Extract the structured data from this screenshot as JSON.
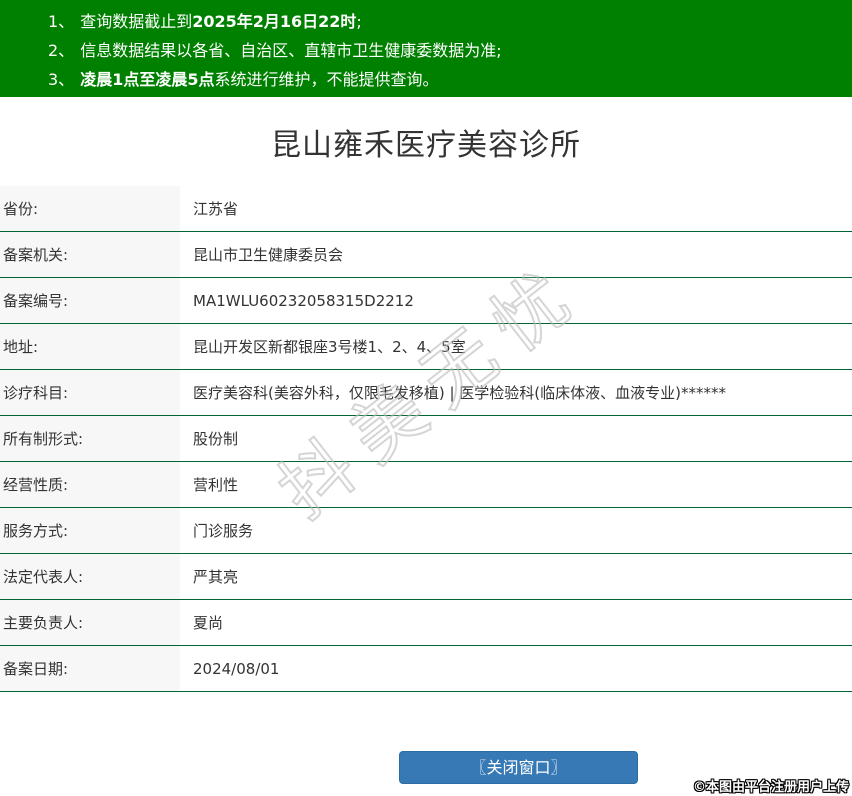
{
  "banner": {
    "background_color": "#008000",
    "lines": [
      {
        "num": "1、",
        "segments": [
          {
            "text": "查询数据截止到",
            "bold": false
          },
          {
            "text": "2025年2月16日22时",
            "bold": true
          },
          {
            "text": ";",
            "bold": false
          }
        ]
      },
      {
        "num": "2、",
        "segments": [
          {
            "text": "信息数据结果以各省、自治区、直辖市卫生健康委数据为准;",
            "bold": false
          }
        ]
      },
      {
        "num": "3、",
        "segments": [
          {
            "text": "凌晨1点至凌晨5点",
            "bold": true
          },
          {
            "text": "系统进行维护，不能提供查询。",
            "bold": false
          }
        ]
      }
    ]
  },
  "title": "昆山雍禾医疗美容诊所",
  "table": {
    "rows": [
      {
        "label": "省份:",
        "value": "江苏省"
      },
      {
        "label": "备案机关:",
        "value": "昆山市卫生健康委员会"
      },
      {
        "label": "备案编号:",
        "value": "MA1WLU60232058315D2212"
      },
      {
        "label": "地址:",
        "value": "昆山开发区新都银座3号楼1、2、4、5室"
      },
      {
        "label": "诊疗科目:",
        "value": "医疗美容科(美容外科，仅限毛发移植) | 医学检验科(临床体液、血液专业)******"
      },
      {
        "label": "所有制形式:",
        "value": "股份制"
      },
      {
        "label": "经营性质:",
        "value": "营利性"
      },
      {
        "label": "服务方式:",
        "value": "门诊服务"
      },
      {
        "label": "法定代表人:",
        "value": "严其亮"
      },
      {
        "label": "主要负责人:",
        "value": "夏尚"
      },
      {
        "label": "备案日期:",
        "value": "2024/08/01"
      }
    ]
  },
  "watermark_text": "抖美无忧",
  "close_button_label": "〖关闭窗口〗",
  "footer_note": "©本图由平台注册用户上传",
  "colors": {
    "banner_green": "#008000",
    "row_divider_green": "#006633",
    "label_cell_bg": "#f7f7f7",
    "button_blue": "#3679b5",
    "text": "#333333"
  }
}
